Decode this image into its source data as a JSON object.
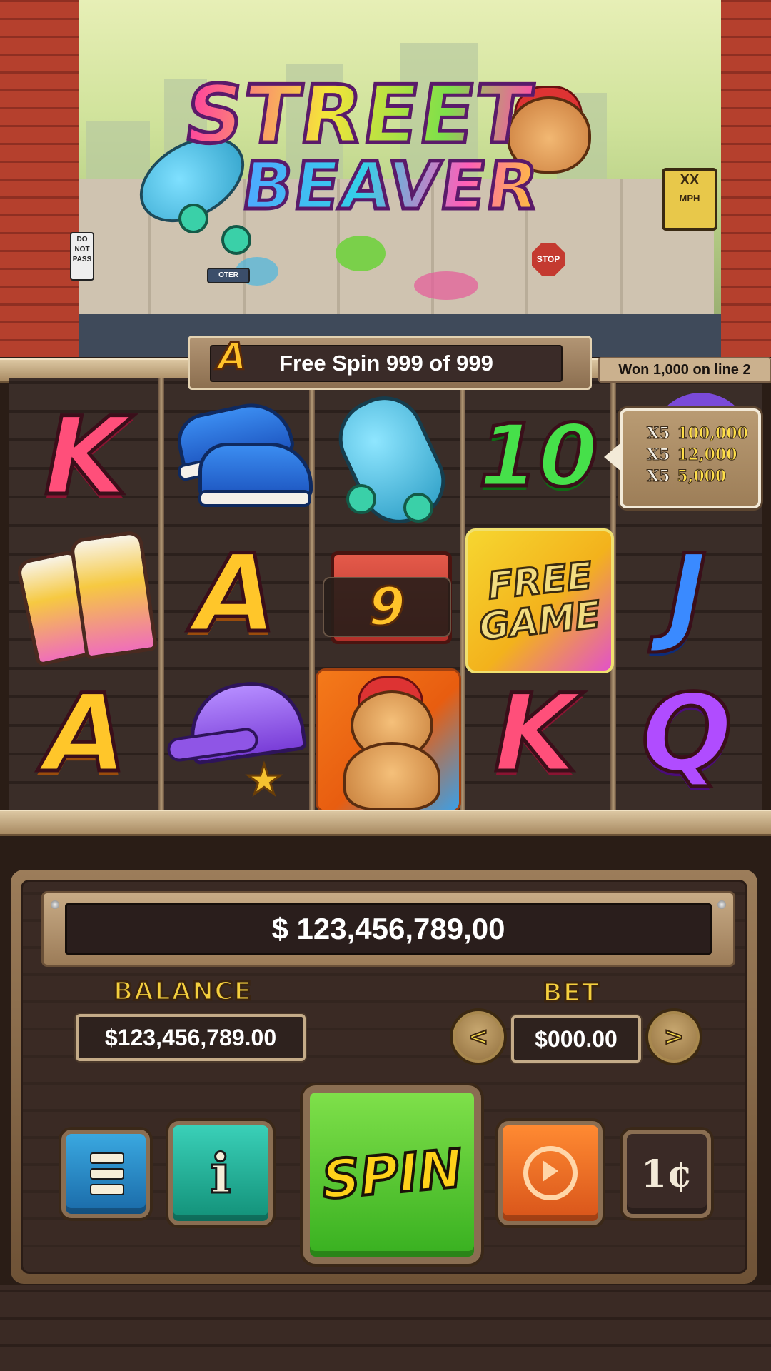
{
  "game": {
    "logo_line1": "STREET",
    "logo_line2": "BEAVER"
  },
  "scenery": {
    "sign_speed": "XX",
    "sign_speed_unit": "MPH",
    "sign_do_not_pass": "DO NOT PASS",
    "sign_stop": "STOP",
    "sign_street": "OTER"
  },
  "free_spin_banner": {
    "icon_letter": "A",
    "text": "Free Spin 999 of 999"
  },
  "win_line_label": "Won 1,000 on line 2",
  "reels": [
    {
      "rows": [
        "K",
        "spray-cans",
        "A"
      ]
    },
    {
      "rows": [
        "sneakers",
        "A",
        "cap"
      ]
    },
    {
      "rows": [
        "skateboard",
        "boombox",
        "beaver-wild"
      ]
    },
    {
      "rows": [
        "10",
        "free-game",
        "K"
      ]
    },
    {
      "rows": [
        "purple-bag",
        "J",
        "Q"
      ]
    }
  ],
  "symbol_text": {
    "k": "K",
    "a": "A",
    "j": "J",
    "q": "Q",
    "ten": "10",
    "free_game_line1": "FREE",
    "free_game_line2": "GAME"
  },
  "multiplier_value": "9",
  "paytable": [
    {
      "count": "X5",
      "value": "100,000"
    },
    {
      "count": "X5",
      "value": "12,000"
    },
    {
      "count": "X5",
      "value": "5,000"
    }
  ],
  "controls": {
    "win_amount": "$ 123,456,789,00",
    "balance_label": "BALANCE",
    "balance_value": "$123,456,789.00",
    "bet_label": "BET",
    "bet_value": "$000.00",
    "bet_decrease": "<",
    "bet_increase": ">",
    "spin_label": "SPIN",
    "coin_label": "1¢"
  },
  "colors": {
    "spin_button": "#5cc934",
    "menu_button": "#2a8ccc",
    "info_button": "#22b09a",
    "autoplay_button": "#f07024",
    "accent_gold": "#f4cf3e"
  },
  "icons": [
    "menu-icon",
    "info-icon",
    "autoplay-icon",
    "coin-value-icon",
    "arrow-left-icon",
    "arrow-right-icon"
  ]
}
